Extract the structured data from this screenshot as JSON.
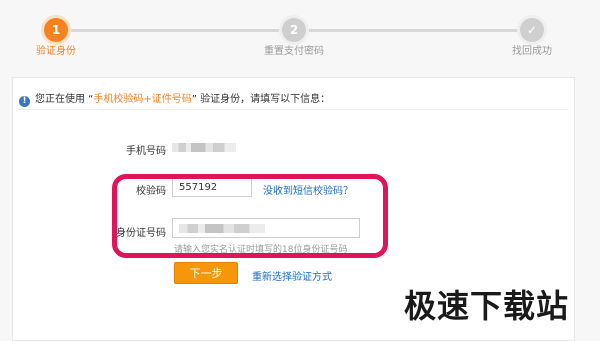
{
  "steps": [
    {
      "number": "1",
      "label": "验证身份",
      "state": "active"
    },
    {
      "number": "2",
      "label": "重置支付密码",
      "state": "pending"
    },
    {
      "number": "✓",
      "label": "找回成功",
      "state": "pending"
    }
  ],
  "notice": {
    "prefix": "您正在使用 “",
    "method": "手机校验码+证件号码",
    "suffix": "” 验证身份，请填写以下信息：",
    "icon": "info-icon"
  },
  "form": {
    "phone_label": "手机号码",
    "code_label": "校验码",
    "code_value": "557192",
    "resend_link": "没收到短信校验码？",
    "id_label": "身份证号码",
    "id_hint": "请输入您实名认证时填写的18位身份证号码"
  },
  "actions": {
    "next_label": "下一步",
    "reselect_link": "重新选择验证方式"
  },
  "watermark": "极速下载站",
  "colors": {
    "accent": "#f58220",
    "button": "#f5960b",
    "link": "#1a6bc4",
    "highlight_box": "#e0145a"
  }
}
